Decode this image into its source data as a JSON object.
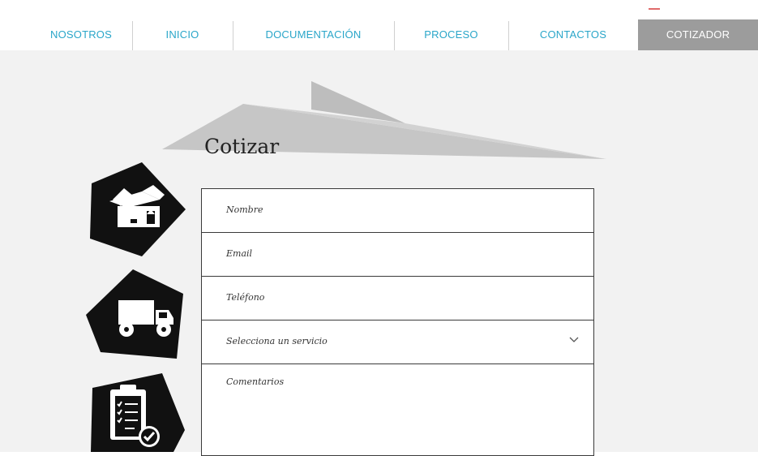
{
  "nav": {
    "items": [
      {
        "label": "NOSOTROS"
      },
      {
        "label": "INICIO"
      },
      {
        "label": "DOCUMENTACIÓN"
      },
      {
        "label": "PROCESO"
      },
      {
        "label": "CONTACTOS"
      },
      {
        "label": "COTIZADOR",
        "active": true
      }
    ]
  },
  "form": {
    "title": "Cotizar",
    "name_placeholder": "Nombre",
    "email_placeholder": "Email",
    "phone_placeholder": "Teléfono",
    "service_placeholder": "Selecciona un servicio",
    "comments_placeholder": "Comentarios"
  },
  "icons": [
    "package-box-icon",
    "delivery-truck-icon",
    "clipboard-checklist-icon"
  ],
  "colors": {
    "nav_text": "#2aa6c9",
    "nav_active_bg": "#9c9c9c",
    "content_bg": "#f2f2f2",
    "plane_gray": "#c4c4c4",
    "icon_badge": "#111111"
  }
}
